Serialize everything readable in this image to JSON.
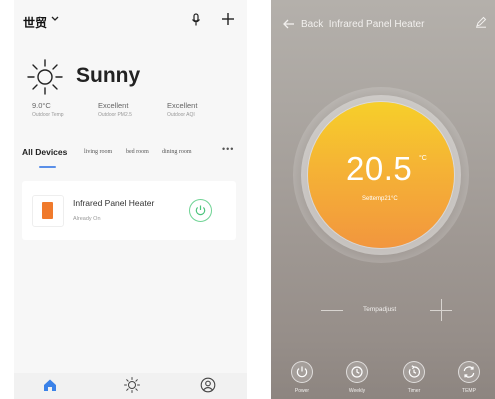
{
  "home": {
    "title": "世贸",
    "weather": {
      "condition": "Sunny",
      "metrics": [
        {
          "value": "9.0°C",
          "label": "Outdoor Temp"
        },
        {
          "value": "Excellent",
          "label": "Outdoor PM2.5"
        },
        {
          "value": "Excellent",
          "label": "Outdoor AQI"
        }
      ]
    },
    "tabs": {
      "active": "All Devices",
      "rooms": [
        "living room",
        "bed room",
        "dining room"
      ],
      "more": "•••"
    },
    "device": {
      "name": "Infrared Panel Heater",
      "status": "Already On"
    },
    "icons": {
      "dropdown": "chevron-down-icon",
      "mic": "microphone-icon",
      "add": "plus-icon",
      "weather": "sun-icon",
      "power": "power-icon",
      "nav": [
        "home-icon",
        "scene-sun-icon",
        "profile-icon"
      ]
    },
    "colors": {
      "accent": "#5a8fe8",
      "power_on": "#6fd394",
      "device": "#f07a2c"
    }
  },
  "heater": {
    "header": {
      "back_label": "Back",
      "title": "Infrared Panel Heater"
    },
    "temperature": {
      "value": "20.5",
      "unit": "°C",
      "settemp": "Settemp21°C"
    },
    "adjust_label": "Tempadjust",
    "controls": [
      {
        "label": "Power",
        "icon": "power-icon"
      },
      {
        "label": "Weekly",
        "icon": "clock-icon"
      },
      {
        "label": "Timer",
        "icon": "timer-icon"
      },
      {
        "label": "TEMP",
        "icon": "refresh-icon"
      }
    ],
    "colors": {
      "dial_top": "#f6cf2a",
      "dial_bottom": "#f2963e"
    }
  }
}
